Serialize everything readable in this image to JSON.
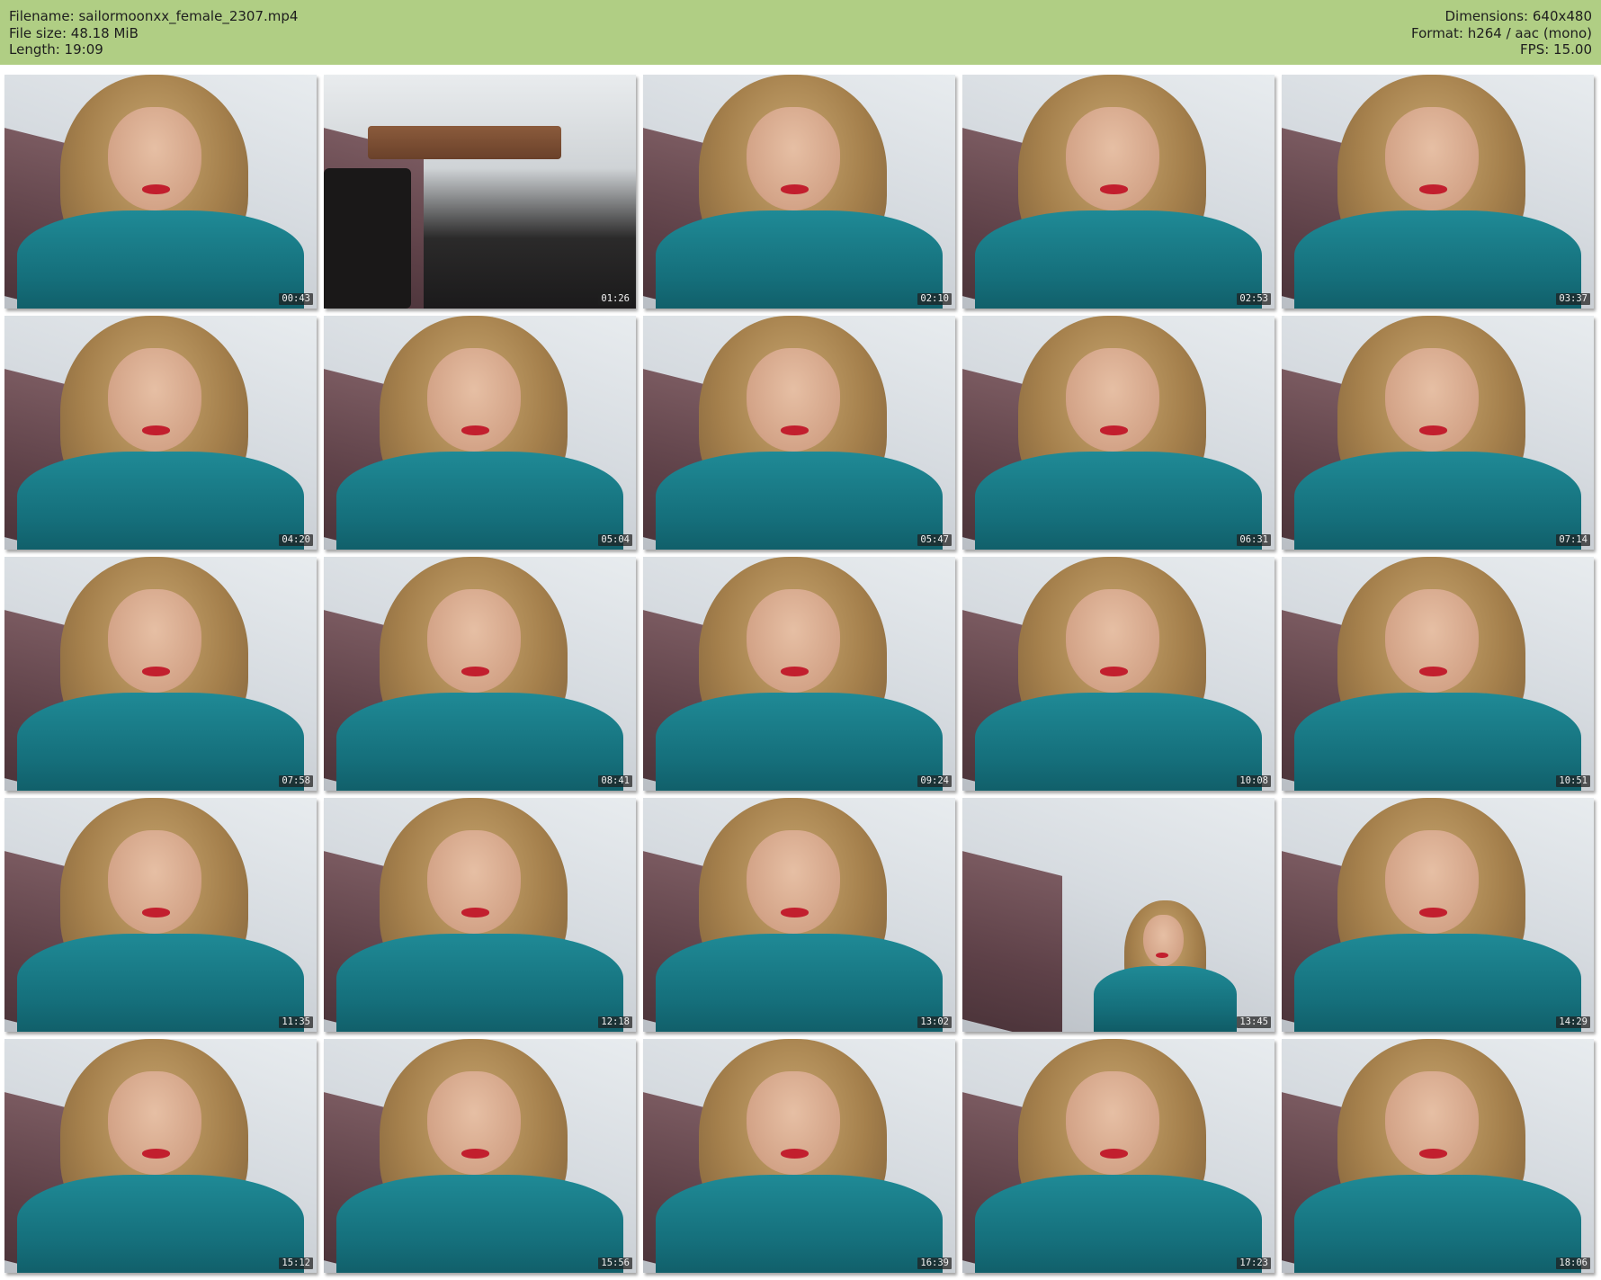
{
  "header": {
    "filename": "Filename: sailormoonxx_female_2307.mp4",
    "file_size": "File size: 48.18 MiB",
    "length": "Length: 19:09",
    "dimensions": "Dimensions: 640x480",
    "format": "Format: h264 / aac (mono)",
    "fps": "FPS: 15.00"
  },
  "colors": {
    "header_bg": "#b0ce84",
    "shirt": "#1f8a96",
    "lips": "#c21f2e"
  },
  "thumbnails": [
    {
      "time": "00:43",
      "kind": "person"
    },
    {
      "time": "01:26",
      "kind": "room"
    },
    {
      "time": "02:10",
      "kind": "person"
    },
    {
      "time": "02:53",
      "kind": "person"
    },
    {
      "time": "03:37",
      "kind": "person"
    },
    {
      "time": "04:20",
      "kind": "person"
    },
    {
      "time": "05:04",
      "kind": "person"
    },
    {
      "time": "05:47",
      "kind": "person"
    },
    {
      "time": "06:31",
      "kind": "person"
    },
    {
      "time": "07:14",
      "kind": "person"
    },
    {
      "time": "07:58",
      "kind": "person"
    },
    {
      "time": "08:41",
      "kind": "person"
    },
    {
      "time": "09:24",
      "kind": "person"
    },
    {
      "time": "10:08",
      "kind": "person"
    },
    {
      "time": "10:51",
      "kind": "person"
    },
    {
      "time": "11:35",
      "kind": "person"
    },
    {
      "time": "12:18",
      "kind": "person"
    },
    {
      "time": "13:02",
      "kind": "person"
    },
    {
      "time": "13:45",
      "kind": "far"
    },
    {
      "time": "14:29",
      "kind": "person"
    },
    {
      "time": "15:12",
      "kind": "person"
    },
    {
      "time": "15:56",
      "kind": "person"
    },
    {
      "time": "16:39",
      "kind": "person"
    },
    {
      "time": "17:23",
      "kind": "person"
    },
    {
      "time": "18:06",
      "kind": "person"
    }
  ]
}
